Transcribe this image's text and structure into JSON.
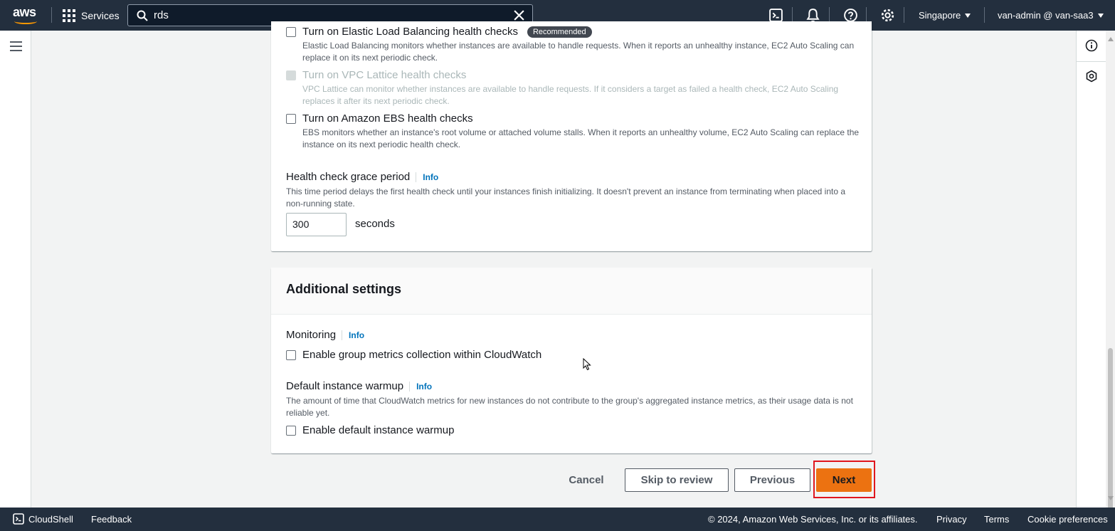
{
  "topnav": {
    "services_label": "Services",
    "search_value": "rds",
    "region_label": "Singapore",
    "account_label": "van-admin @ van-saa3"
  },
  "health_checks": {
    "elb": {
      "label": "Turn on Elastic Load Balancing health checks",
      "badge": "Recommended",
      "description": "Elastic Load Balancing monitors whether instances are available to handle requests. When it reports an unhealthy instance, EC2 Auto Scaling can replace it on its next periodic check."
    },
    "vpc_lattice": {
      "label": "Turn on VPC Lattice health checks",
      "description": "VPC Lattice can monitor whether instances are available to handle requests. If it considers a target as failed a health check, EC2 Auto Scaling replaces it after its next periodic check."
    },
    "ebs": {
      "label": "Turn on Amazon EBS health checks",
      "description": "EBS monitors whether an instance's root volume or attached volume stalls. When it reports an unhealthy volume, EC2 Auto Scaling can replace the instance on its next periodic health check."
    },
    "grace_period": {
      "label": "Health check grace period",
      "info": "Info",
      "description": "This time period delays the first health check until your instances finish initializing. It doesn't prevent an instance from terminating when placed into a non-running state.",
      "value": "300",
      "unit": "seconds"
    }
  },
  "additional_settings": {
    "title": "Additional settings",
    "monitoring": {
      "label": "Monitoring",
      "info": "Info",
      "checkbox_label": "Enable group metrics collection within CloudWatch"
    },
    "warmup": {
      "label": "Default instance warmup",
      "info": "Info",
      "description": "The amount of time that CloudWatch metrics for new instances do not contribute to the group's aggregated instance metrics, as their usage data is not reliable yet.",
      "checkbox_label": "Enable default instance warmup"
    }
  },
  "actions": {
    "cancel": "Cancel",
    "skip": "Skip to review",
    "previous": "Previous",
    "next": "Next"
  },
  "bottombar": {
    "cloudshell": "CloudShell",
    "feedback": "Feedback",
    "copyright": "© 2024, Amazon Web Services, Inc. or its affiliates.",
    "privacy": "Privacy",
    "terms": "Terms",
    "cookies": "Cookie preferences"
  },
  "colors": {
    "nav_bg": "#232f3e",
    "primary_button": "#ec7211",
    "link": "#0073bb",
    "highlight": "#e0161e"
  }
}
